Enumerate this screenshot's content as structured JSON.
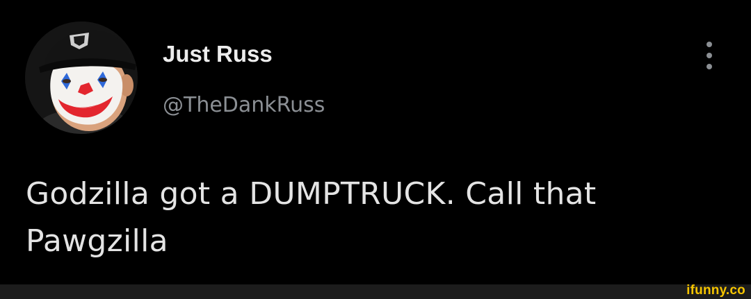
{
  "tweet": {
    "display_name": "Just Russ",
    "handle": "@TheDankRuss",
    "text": "Godzilla got a DUMPTRUCK. Call that Pawgzilla",
    "avatar": "clown-face-profile-photo",
    "more_icon": "more-vertical-icon"
  },
  "footer": {
    "watermark": "ifunny.co"
  },
  "colors": {
    "background": "#000000",
    "name": "#ededed",
    "handle": "#8b8f94",
    "body_text": "#e4e4e4",
    "footer_bar": "#1c1c1c",
    "watermark": "#f5c400"
  }
}
